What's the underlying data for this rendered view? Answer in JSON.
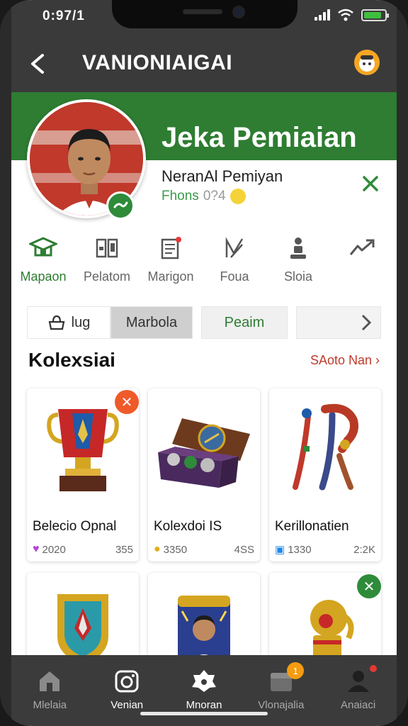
{
  "status_bar": {
    "time": "0:97/1"
  },
  "app_bar": {
    "title": "VANIONIAIGAI",
    "avatar_icon": "user-avatar-icon"
  },
  "profile": {
    "name": "Jeka Pemiaian",
    "subtitle": "NeranAl Pemiyan",
    "meta_label": "Fhons",
    "meta_value": "0?4",
    "band_color": "#2e7d32"
  },
  "categories": [
    {
      "label": "Mapaon",
      "icon": "graduation-cap-icon",
      "active": true
    },
    {
      "label": "Pelatom",
      "icon": "book-icon",
      "active": false
    },
    {
      "label": "Marigon",
      "icon": "notepad-icon",
      "active": false
    },
    {
      "label": "Foua",
      "icon": "pen-icon",
      "active": false
    },
    {
      "label": "Sloia",
      "icon": "figure-icon",
      "active": false
    },
    {
      "label": "",
      "icon": "share-arrow-icon",
      "active": false
    }
  ],
  "tabs": [
    {
      "label": "lug",
      "icon": "bag-icon"
    },
    {
      "label": "Marbola",
      "selected": true
    },
    {
      "label": "Peaim"
    },
    {
      "label": "",
      "icon": "chevron-right-icon"
    }
  ],
  "collection": {
    "title": "Kolexsiai",
    "see_all": "SAoto Nan",
    "items": [
      {
        "name": "Belecio Opnal",
        "stat1": "2020",
        "stat2": "355",
        "badge": "close",
        "stat_icon": "heart-icon"
      },
      {
        "name": "Kolexdoi IS",
        "stat1": "3350",
        "stat2": "4SS",
        "badge": "",
        "stat_icon": "coin-icon"
      },
      {
        "name": "Kerillonatien",
        "stat1": "1330",
        "stat2": "2:2K",
        "badge": "",
        "stat_icon": "tag-icon"
      },
      {
        "name": "",
        "stat1": "",
        "stat2": "",
        "badge": "",
        "stat_icon": ""
      },
      {
        "name": "",
        "stat1": "",
        "stat2": "",
        "badge": "",
        "stat_icon": ""
      },
      {
        "name": "",
        "stat1": "",
        "stat2": "",
        "badge": "check",
        "stat_icon": ""
      }
    ]
  },
  "bottom_nav": [
    {
      "label": "Mlelaia",
      "icon": "home-icon"
    },
    {
      "label": "Venian",
      "icon": "camera-icon"
    },
    {
      "label": "Mnoran",
      "icon": "star-badge-icon",
      "active": true
    },
    {
      "label": "Vlonajalia",
      "icon": "inbox-icon",
      "badge": "1"
    },
    {
      "label": "Anaiaci",
      "icon": "person-icon"
    }
  ]
}
